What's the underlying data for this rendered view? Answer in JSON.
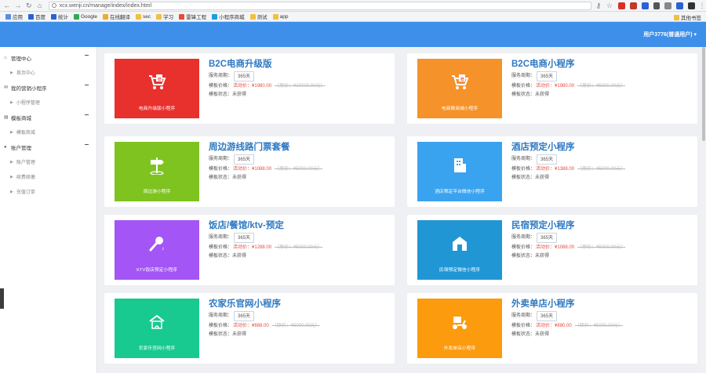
{
  "browser": {
    "url": "xcx.wenji.cn/manage/index/index.html",
    "bookmarks": [
      {
        "label": "应用",
        "color": "#5a8de0"
      },
      {
        "label": "百度",
        "color": "#2a62d6"
      },
      {
        "label": "统计",
        "color": "#2a62d6"
      },
      {
        "label": "Google",
        "color": "#34a853"
      },
      {
        "label": "在线翻译",
        "color": "#e8b030"
      },
      {
        "label": "sec",
        "color": "#f0c040"
      },
      {
        "label": "学习",
        "color": "#f0c040"
      },
      {
        "label": "雷锋工程",
        "color": "#e74c3c"
      },
      {
        "label": "小程序商城",
        "color": "#1aa0e0"
      },
      {
        "label": "测试",
        "color": "#f0c040"
      },
      {
        "label": "app",
        "color": "#f0c040"
      }
    ],
    "other_bookmarks": "其他书签"
  },
  "header": {
    "user": "用户3776(普通用户) ▾"
  },
  "sidebar": {
    "groups": [
      {
        "label": "管理中心",
        "icon": "home-icon",
        "items": [
          "首页中心"
        ]
      },
      {
        "label": "我的营销小程序",
        "icon": "chat-icon",
        "items": [
          "小程序管理"
        ]
      },
      {
        "label": "模板商城",
        "icon": "store-icon",
        "items": [
          "模板商城"
        ]
      },
      {
        "label": "账户管理",
        "icon": "user-icon",
        "items": [
          "账户管理",
          "续费续缴",
          "充值订单"
        ]
      }
    ]
  },
  "labels": {
    "service_period": "服务周期：",
    "template_price": "模板价格：",
    "promo": "活动价：",
    "original": "原价：",
    "status": "模板状态：未获得"
  },
  "cards": [
    {
      "title": "B2C电商升级版",
      "period": "365天",
      "promo_price": "¥1980.00",
      "original_price": "¥10000.00元",
      "thumb_label": "电商升级版小程序",
      "color": "#e8302d",
      "icon": "cart-icon"
    },
    {
      "title": "B2C电商小程序",
      "period": "365天",
      "promo_price": "¥1980.00",
      "original_price": "¥5000.00元",
      "thumb_label": "电商微商城小程序",
      "color": "#f5922a",
      "icon": "cart-icon"
    },
    {
      "title": "周边游线路门票套餐",
      "period": "365天",
      "promo_price": "¥1088.00",
      "original_price": "¥5000.00元",
      "thumb_label": "周边游小程序",
      "color": "#7ec320",
      "icon": "signpost-icon"
    },
    {
      "title": "酒店预定小程序",
      "period": "365天",
      "promo_price": "¥1388.00",
      "original_price": "¥5000.00元",
      "thumb_label": "酒店预定平台微信小程序",
      "color": "#3aa3f0",
      "icon": "building-icon"
    },
    {
      "title": "饭店/餐馆/ktv-预定",
      "period": "365天",
      "promo_price": "¥1288.00",
      "original_price": "¥5000.00元",
      "thumb_label": "KTV饭店预定小程序",
      "color": "#a355f5",
      "icon": "microphone-icon"
    },
    {
      "title": "民宿预定小程序",
      "period": "365天",
      "promo_price": "¥1088.00",
      "original_price": "¥5000.00元",
      "thumb_label": "民宿预定微信小程序",
      "color": "#2196d5",
      "icon": "house-icon"
    },
    {
      "title": "农家乐官网小程序",
      "period": "365天",
      "promo_price": "¥888.00",
      "original_price": "¥5000.00元",
      "thumb_label": "农家乐官网小程序",
      "color": "#18c990",
      "icon": "farmhouse-icon"
    },
    {
      "title": "外卖单店小程序",
      "period": "365天",
      "promo_price": "¥880.00",
      "original_price": "¥5000.00元",
      "thumb_label": "外卖单店小程序",
      "color": "#fb9b0d",
      "icon": "scooter-icon"
    }
  ]
}
